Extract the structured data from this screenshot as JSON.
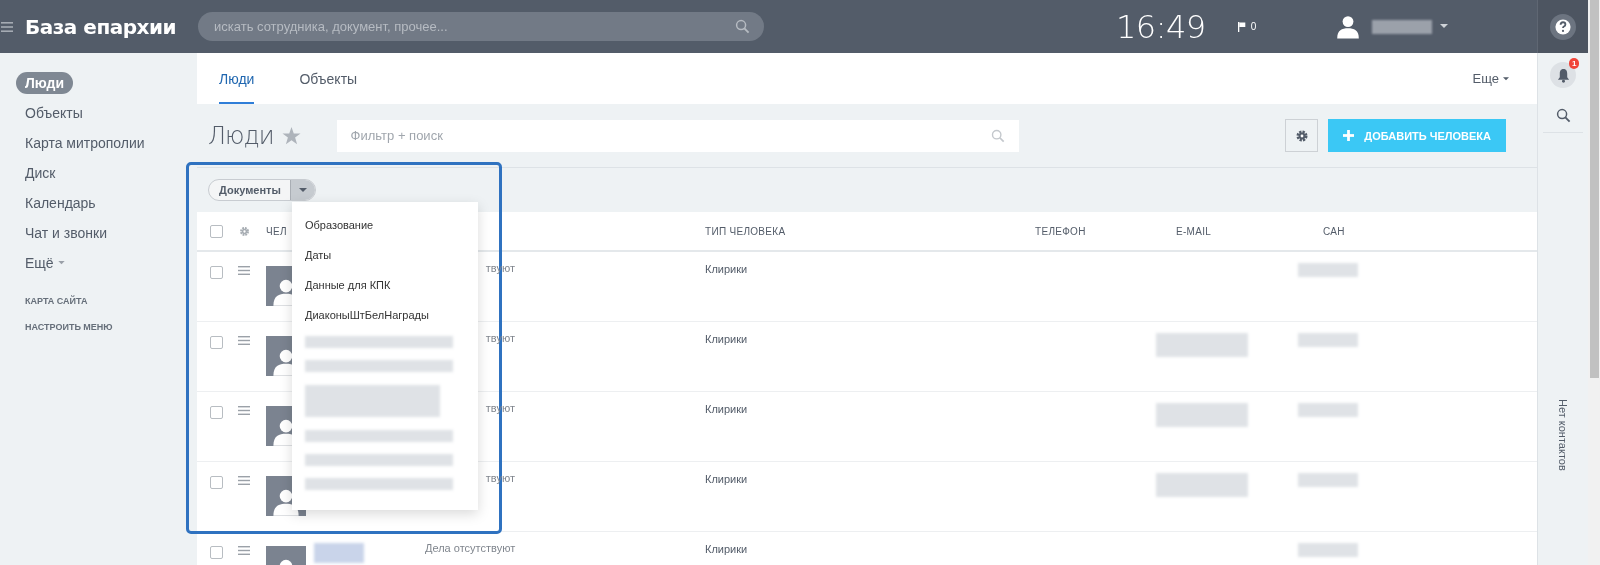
{
  "header": {
    "title": "База епархии",
    "search": {
      "placeholder": "искать сотрудника, документ, прочее..."
    },
    "clock": "16:49",
    "flag_count": "0",
    "user_name_redacted": true
  },
  "sidebar": {
    "items": [
      {
        "label": "Люди",
        "selected": true
      },
      {
        "label": "Объекты",
        "selected": false
      },
      {
        "label": "Карта митрополии",
        "selected": false
      },
      {
        "label": "Диск",
        "selected": false
      },
      {
        "label": "Календарь",
        "selected": false
      },
      {
        "label": "Чат и звонки",
        "selected": false
      },
      {
        "label": "Ещё",
        "selected": false,
        "kind": "more"
      }
    ],
    "links": [
      "КАРТА САЙТА",
      "НАСТРОИТЬ МЕНЮ"
    ]
  },
  "tabs": [
    {
      "label": "Люди",
      "selected": true
    },
    {
      "label": "Объекты",
      "selected": false
    }
  ],
  "tabs_more": "Еще",
  "page_title": "Люди",
  "filter": {
    "placeholder": "Фильтр + поиск"
  },
  "add_button": "ДОБАВИТЬ ЧЕЛОВЕКА",
  "split_button": "Документы",
  "dropdown": {
    "items": [
      {
        "kind": "text",
        "label": "Образование"
      },
      {
        "kind": "text",
        "label": "Даты"
      },
      {
        "kind": "text",
        "label": "Данные для КПК"
      },
      {
        "kind": "text",
        "label": "ДиаконыШтБелНаграды"
      },
      {
        "kind": "redacted"
      },
      {
        "kind": "redacted"
      },
      {
        "kind": "redacted_tall"
      },
      {
        "kind": "redacted"
      },
      {
        "kind": "redacted"
      },
      {
        "kind": "redacted"
      }
    ]
  },
  "highlight_frame": true,
  "table": {
    "all_checked": false,
    "columns": [
      "ЧЕЛ",
      "ТИП ЧЕЛОВЕКА",
      "ТЕЛЕФОН",
      "E-MAIL",
      "САН"
    ],
    "rows": [
      {
        "checked": false,
        "deals": "твуют",
        "type": "Клирики",
        "name_redacted": false,
        "email_redacted": false,
        "rank_redacted": true
      },
      {
        "checked": false,
        "deals": "твуют",
        "type": "Клирики",
        "name_redacted": false,
        "email_redacted": true,
        "rank_redacted": true
      },
      {
        "checked": false,
        "deals": "твуют",
        "type": "Клирики",
        "name_redacted": false,
        "email_redacted": true,
        "rank_redacted": true
      },
      {
        "checked": false,
        "deals": "твуют",
        "type": "Клирики",
        "name_redacted": false,
        "email_redacted": true,
        "rank_redacted": true
      },
      {
        "checked": false,
        "deals": "Дела отсутствуют",
        "type": "Клирики",
        "name_redacted": true,
        "email_redacted": false,
        "rank_redacted": true
      }
    ]
  },
  "right_panel": {
    "notification_count": "1",
    "contacts_text": "Нет контактов"
  }
}
